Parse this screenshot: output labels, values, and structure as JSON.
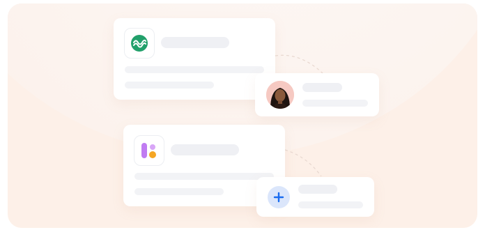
{
  "colors": {
    "frame_background": "#fdf0e8",
    "card_background": "#ffffff",
    "placeholder_bar": "#eff0f4",
    "logo_green": "#22a06b",
    "logo_purple": "#c07cf2",
    "logo_orange": "#f5a623",
    "plus_blue": "#1a6cf0",
    "plus_circle_bg": "#dbe6fb"
  },
  "icons": {
    "card_one_logo": "green-wave-logo-icon",
    "card_two_logo": "purple-orange-app-logo-icon",
    "user_avatar": "user-avatar",
    "add_button": "plus-icon"
  }
}
